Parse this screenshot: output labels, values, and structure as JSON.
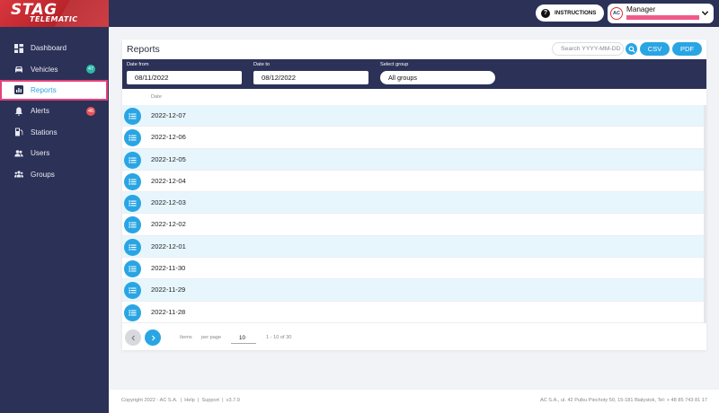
{
  "brand": {
    "main": "STAG",
    "sub": "TELEMATIC"
  },
  "sidebar": {
    "items": [
      {
        "label": "Dashboard",
        "icon": "dashboard-icon",
        "badge": ""
      },
      {
        "label": "Vehicles",
        "icon": "car-icon",
        "badge": "47"
      },
      {
        "label": "Reports",
        "icon": "chart-icon",
        "badge": "",
        "active": true
      },
      {
        "label": "Alerts",
        "icon": "bell-icon",
        "badge": "46"
      },
      {
        "label": "Stations",
        "icon": "gas-station-icon",
        "badge": ""
      },
      {
        "label": "Users",
        "icon": "users-icon",
        "badge": ""
      },
      {
        "label": "Groups",
        "icon": "groups-icon",
        "badge": ""
      }
    ]
  },
  "header": {
    "instructions_label": "INSTRUCTIONS",
    "user_role": "Manager",
    "avatar_initials": "AC"
  },
  "reports": {
    "title": "Reports",
    "search_placeholder": "Search YYYY-MM-DD",
    "csv_label": "CSV",
    "pdf_label": "PDF",
    "filters": {
      "date_from_label": "Date from",
      "date_from_value": "08/11/2022",
      "date_to_label": "Date to",
      "date_to_value": "08/12/2022",
      "group_label": "Select group",
      "group_value": "All groups"
    },
    "column_header": "Date",
    "rows": [
      "2022-12-07",
      "2022-12-06",
      "2022-12-05",
      "2022-12-04",
      "2022-12-03",
      "2022-12-02",
      "2022-12-01",
      "2022-11-30",
      "2022-11-29",
      "2022-11-28"
    ],
    "pager": {
      "items_label": "Items",
      "per_page_label": "per page",
      "per_page_value": "10",
      "range_text": "1 - 10 of 30"
    }
  },
  "footer": {
    "copyright": "Copyright 2022 - AC S.A.",
    "help": "Help",
    "support": "Support",
    "version": "v3.7.9",
    "address": "AC S.A., ul. 42 Pulku Piechoty 50, 15-181 Białystok, Tel: + 48 85 743 81 17"
  },
  "colors": {
    "navy": "#2c3157",
    "accent": "#2aa5e4",
    "highlight": "#e2417a",
    "row_alt": "#e7f6fc"
  }
}
